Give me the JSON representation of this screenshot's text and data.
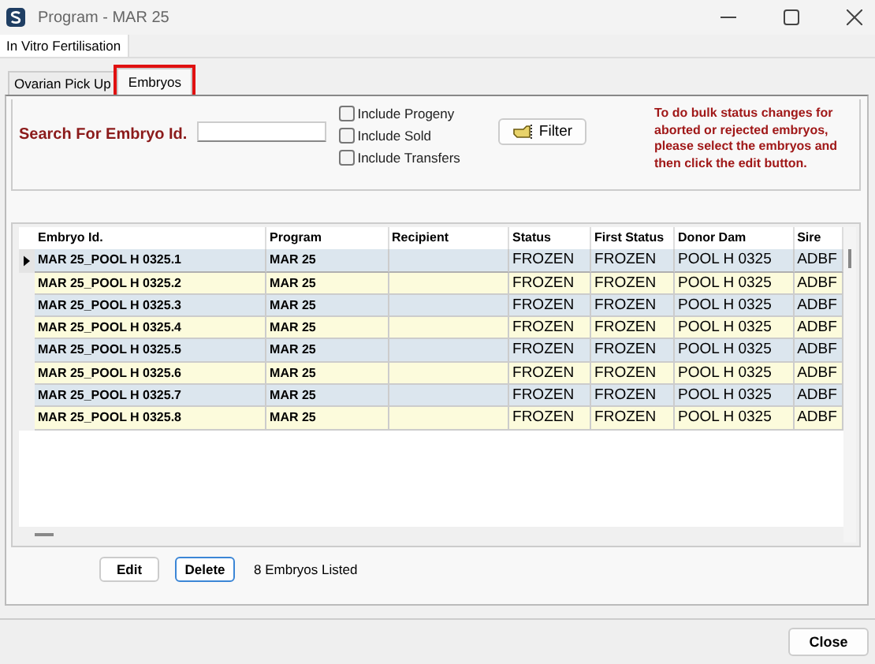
{
  "window": {
    "title": "Program - MAR 25"
  },
  "outer_tabs": [
    {
      "label": "In Vitro Fertilisation",
      "selected": true
    }
  ],
  "tabs": [
    {
      "label": "Ovarian Pick Up",
      "selected": false,
      "highlighted": false
    },
    {
      "label": "Embryos",
      "selected": true,
      "highlighted": true
    }
  ],
  "search": {
    "label": "Search For Embryo Id."
  },
  "options": [
    {
      "label": "Include Progeny",
      "checked": false
    },
    {
      "label": "Include Sold",
      "checked": false
    },
    {
      "label": "Include Transfers",
      "checked": false
    }
  ],
  "filter_button": "Filter",
  "hint": "To do bulk status changes for aborted or rejected embryos, please select the embryos and then click the edit button.",
  "table": {
    "columns": [
      "Embryo Id.",
      "Program",
      "Recipient",
      "Status",
      "First Status",
      "Donor Dam",
      "Sire"
    ],
    "rows": [
      {
        "current": true,
        "cells": [
          "MAR 25_POOL H 0325.1",
          "MAR 25",
          "",
          "FROZEN",
          "FROZEN",
          "POOL H 0325",
          "ADBF"
        ]
      },
      {
        "current": false,
        "cells": [
          "MAR 25_POOL H 0325.2",
          "MAR 25",
          "",
          "FROZEN",
          "FROZEN",
          "POOL H 0325",
          "ADBF"
        ]
      },
      {
        "current": false,
        "cells": [
          "MAR 25_POOL H 0325.3",
          "MAR 25",
          "",
          "FROZEN",
          "FROZEN",
          "POOL H 0325",
          "ADBF"
        ]
      },
      {
        "current": false,
        "cells": [
          "MAR 25_POOL H 0325.4",
          "MAR 25",
          "",
          "FROZEN",
          "FROZEN",
          "POOL H 0325",
          "ADBF"
        ]
      },
      {
        "current": false,
        "cells": [
          "MAR 25_POOL H 0325.5",
          "MAR 25",
          "",
          "FROZEN",
          "FROZEN",
          "POOL H 0325",
          "ADBF"
        ]
      },
      {
        "current": false,
        "cells": [
          "MAR 25_POOL H 0325.6",
          "MAR 25",
          "",
          "FROZEN",
          "FROZEN",
          "POOL H 0325",
          "ADBF"
        ]
      },
      {
        "current": false,
        "cells": [
          "MAR 25_POOL H 0325.7",
          "MAR 25",
          "",
          "FROZEN",
          "FROZEN",
          "POOL H 0325",
          "ADBF"
        ]
      },
      {
        "current": false,
        "cells": [
          "MAR 25_POOL H 0325.8",
          "MAR 25",
          "",
          "FROZEN",
          "FROZEN",
          "POOL H 0325",
          "ADBF"
        ]
      }
    ]
  },
  "actions": [
    {
      "label": "Edit",
      "focused": false
    },
    {
      "label": "Delete",
      "focused": true
    }
  ],
  "count": "8 Embryos Listed",
  "close_button": "Close"
}
